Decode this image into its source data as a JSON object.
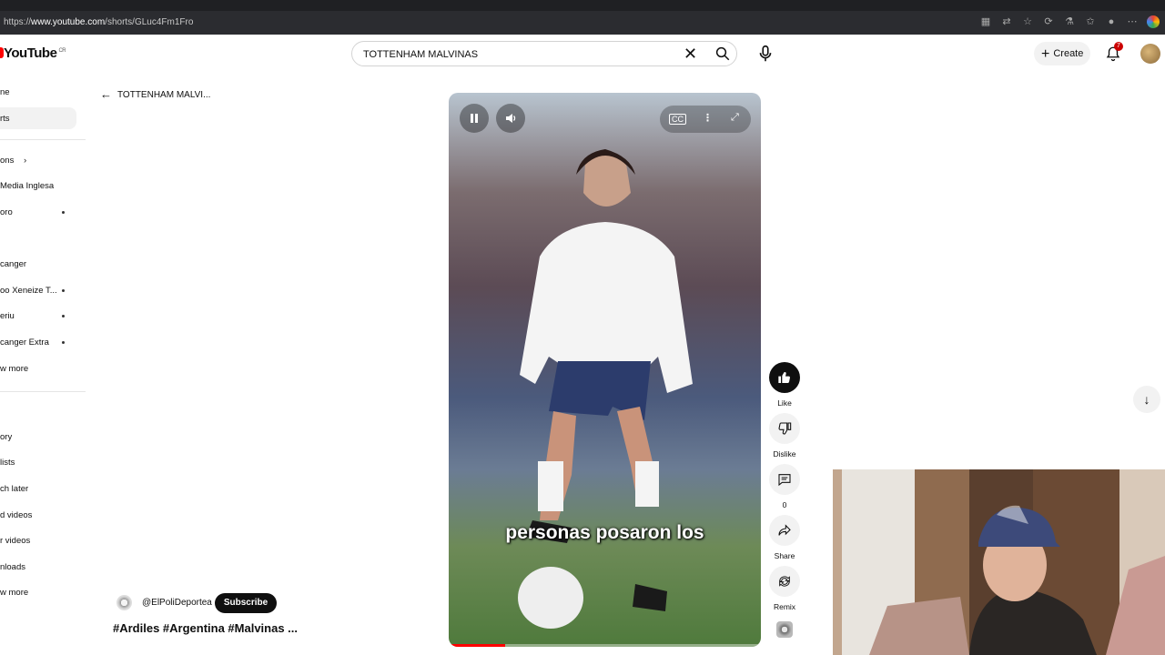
{
  "browser": {
    "url_prefix": "https://",
    "url_host": "www.youtube.com",
    "url_path": "/shorts/GLuc4Fm1Fro",
    "toolbar_icons": [
      "apps-icon",
      "translate-icon",
      "star-icon",
      "extension-icon",
      "lab-icon",
      "favorites-icon",
      "profile-icon",
      "more-icon",
      "copilot-icon"
    ]
  },
  "header": {
    "logo_text": "YouTube",
    "logo_country": "CR",
    "search_query": "TOTTENHAM MALVINAS",
    "create_label": "Create",
    "notifications_count": "7"
  },
  "sidebar": {
    "items": [
      {
        "label": "ne",
        "dot": false
      },
      {
        "label": "rts",
        "dot": false,
        "selected": true
      },
      {
        "label": "ons",
        "dot": false,
        "chevron": true
      },
      {
        "label": "Media Inglesa",
        "dot": false
      },
      {
        "label": "oro",
        "dot": true
      },
      {
        "label": "",
        "dot": true
      },
      {
        "label": "canger",
        "dot": false
      },
      {
        "label": "oo Xeneize T...",
        "dot": true
      },
      {
        "label": "eriu",
        "dot": true
      },
      {
        "label": "canger Extra",
        "dot": true
      },
      {
        "label": "w more",
        "dot": false
      },
      {
        "label": "ory",
        "dot": false
      },
      {
        "label": "lists",
        "dot": false
      },
      {
        "label": "ch later",
        "dot": false
      },
      {
        "label": "d videos",
        "dot": false
      },
      {
        "label": "r videos",
        "dot": false
      },
      {
        "label": "nloads",
        "dot": false
      },
      {
        "label": "w more",
        "dot": false
      }
    ]
  },
  "short": {
    "back_title": "TOTTENHAM MALVI...",
    "caption": "personas posaron los",
    "progress": 0.18,
    "channel_handle": "@ElPoliDeportea",
    "subscribe_label": "Subscribe",
    "description": "#Ardiles #Argentina #Malvinas ..."
  },
  "actions": {
    "like": "Like",
    "dislike": "Dislike",
    "comments": "0",
    "share": "Share",
    "remix": "Remix"
  },
  "colors": {
    "accent": "#ff0000",
    "text": "#0f0f0f",
    "chip_bg": "#f2f2f2"
  }
}
